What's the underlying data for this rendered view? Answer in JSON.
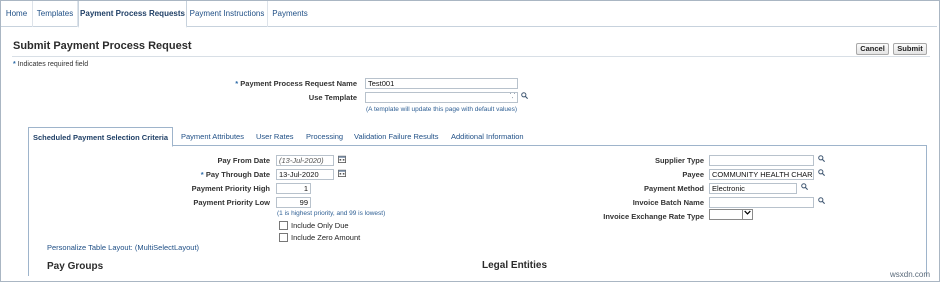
{
  "nav": {
    "tabs": [
      {
        "label": "Home"
      },
      {
        "label": "Templates"
      },
      {
        "label": "Payment Process Requests"
      },
      {
        "label": "Payment Instructions"
      },
      {
        "label": "Payments"
      }
    ],
    "active": "Payment Process Requests"
  },
  "page": {
    "title": "Submit Payment Process Request",
    "required_note": "Indicates required field",
    "required_marker": "*",
    "cancel_label": "Cancel",
    "submit_label": "Submit"
  },
  "header_form": {
    "ppr_name_label": "Payment Process Request Name",
    "ppr_name_value": "Test001",
    "use_template_label": "Use Template",
    "use_template_value": "",
    "template_hint": "(A template will update this page with default values)"
  },
  "subtabs": [
    {
      "label": "Scheduled Payment Selection Criteria"
    },
    {
      "label": "Payment Attributes"
    },
    {
      "label": "User Rates"
    },
    {
      "label": "Processing"
    },
    {
      "label": "Validation Failure Results"
    },
    {
      "label": "Additional Information"
    }
  ],
  "criteria": {
    "pay_from_label": "Pay From Date",
    "pay_from_value": "(13-Jul-2020)",
    "pay_through_label": "Pay Through Date",
    "pay_through_value": "13-Jul-2020",
    "priority_high_label": "Payment Priority High",
    "priority_high_value": "1",
    "priority_low_label": "Payment Priority Low",
    "priority_low_value": "99",
    "priority_hint": "(1 is highest priority, and 99 is lowest)",
    "include_only_due": "Include Only Due",
    "include_zero_amount": "Include Zero Amount",
    "personalize_link": "Personalize Table Layout: (MultiSelectLayout)",
    "supplier_type_label": "Supplier Type",
    "supplier_type_value": "",
    "payee_label": "Payee",
    "payee_value": "COMMUNITY HEALTH CHAR",
    "payment_method_label": "Payment Method",
    "payment_method_value": "Electronic",
    "invoice_batch_label": "Invoice Batch Name",
    "invoice_batch_value": "",
    "exchange_rate_label": "Invoice Exchange Rate Type",
    "exchange_rate_value": ""
  },
  "sections": {
    "pay_groups": "Pay Groups",
    "legal_entities": "Legal Entities"
  },
  "watermark": "wsxdn.com",
  "icons": {
    "search": "search-icon",
    "calendar": "calendar-icon",
    "dropdown": "chevron-down-icon"
  },
  "colors": {
    "link": "#1f4f86",
    "required": "#2e6ba8",
    "tab_border": "#9eb4cb"
  }
}
